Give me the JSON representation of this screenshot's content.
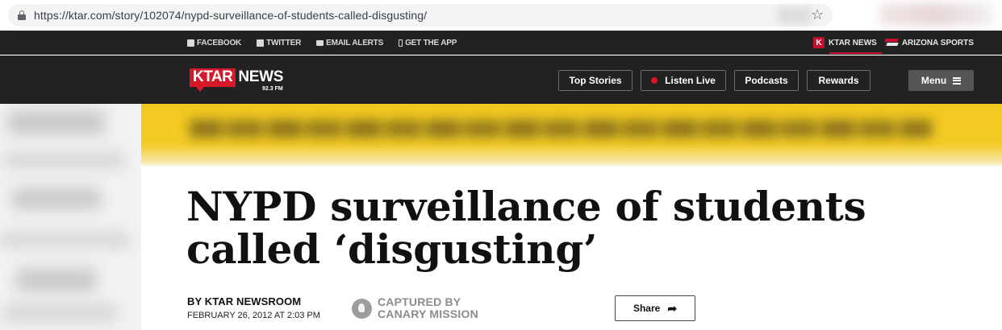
{
  "browser": {
    "url": "https://ktar.com/story/102074/nypd-surveillance-of-students-called-disgusting/",
    "bookmark_icon": "star-icon"
  },
  "topbar": {
    "social": [
      {
        "label": "FACEBOOK",
        "icon": "facebook-icon"
      },
      {
        "label": "TWITTER",
        "icon": "twitter-icon"
      },
      {
        "label": "EMAIL ALERTS",
        "icon": "mail-icon"
      },
      {
        "label": "GET THE APP",
        "icon": "phone-icon"
      }
    ],
    "brands": [
      {
        "label": "KTAR NEWS",
        "icon": "ktar-k-logo"
      },
      {
        "label": "ARIZONA SPORTS",
        "icon": "arizona-sports-logo"
      }
    ]
  },
  "nav": {
    "logo_ktar": "KTAR",
    "logo_news": "NEWS",
    "logo_freq": "92.3 FM",
    "buttons": [
      "Top Stories",
      "Listen Live",
      "Podcasts",
      "Rewards"
    ],
    "menu_label": "Menu"
  },
  "article": {
    "headline": "NYPD surveillance of students called ‘disgusting’",
    "byline": "BY KTAR NEWSROOM",
    "date": "FEBRUARY 26, 2012 AT 2:03 PM",
    "capture_line1": "CAPTURED BY",
    "capture_line2": "CANARY MISSION",
    "share_label": "Share"
  },
  "colors": {
    "brand_red": "#d7182a",
    "nav_bg": "#222222",
    "banner_yellow": "#f1c81f"
  }
}
